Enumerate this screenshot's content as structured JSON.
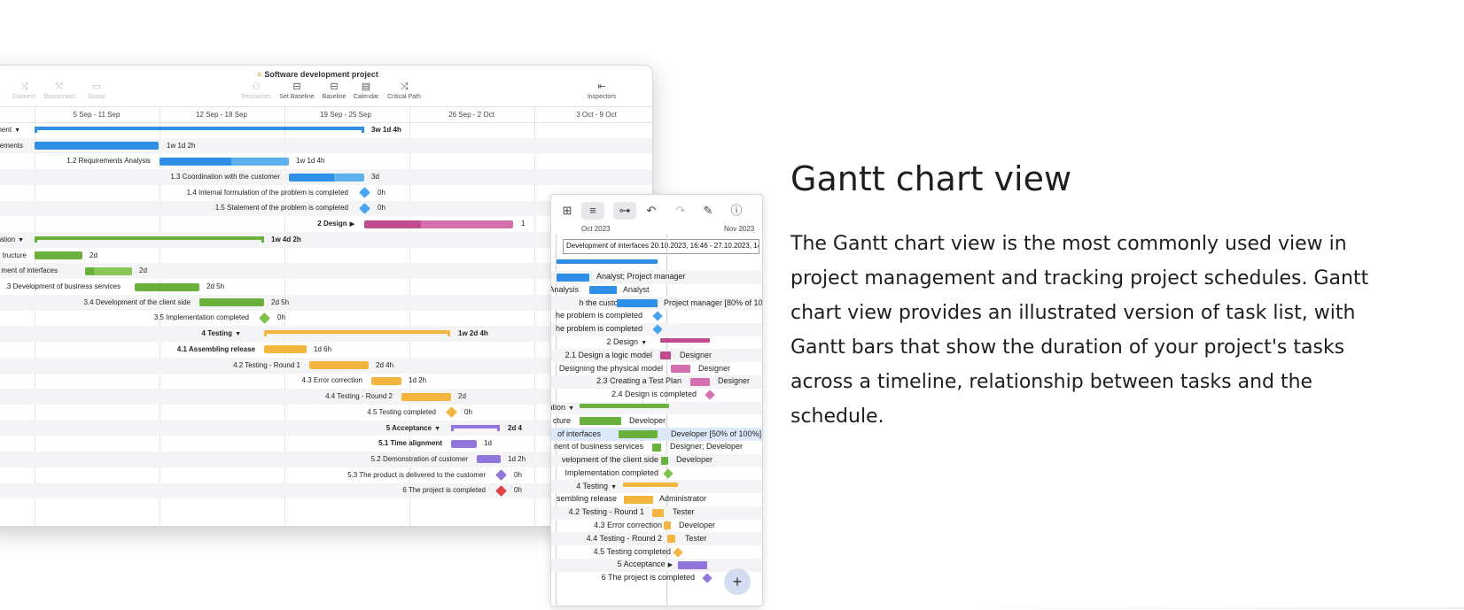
{
  "colors": {
    "blue": "#2f8ee6",
    "blue_light": "#5fb0ef",
    "green": "#6ab03c",
    "green_light": "#8cc55a",
    "magenta": "#c24a8e",
    "pink": "#d66fae",
    "orange": "#f3b53d",
    "purple": "#9376db",
    "red": "#e04348",
    "diamond_blue": "#4aa4ef",
    "diamond_green": "#7dc24b"
  },
  "desktop": {
    "title": "Software development project",
    "toolbar": [
      {
        "icon": "connect-icon",
        "label": "Connect",
        "enabled": false
      },
      {
        "icon": "disconnect-icon",
        "label": "Disconnect",
        "enabled": false
      },
      {
        "icon": "group-icon",
        "label": "Group",
        "enabled": false
      },
      {
        "icon": "resources-icon",
        "label": "Resources",
        "enabled": false
      },
      {
        "icon": "set-baseline-icon",
        "label": "Set Baseline",
        "enabled": true
      },
      {
        "icon": "baseline-icon",
        "label": "Baseline",
        "enabled": true
      },
      {
        "icon": "calendar-icon",
        "label": "Calendar",
        "enabled": true
      },
      {
        "icon": "critical-path-icon",
        "label": "Critical Path",
        "enabled": true
      },
      {
        "icon": "inspectors-icon",
        "label": "Inspectors",
        "enabled": true
      }
    ],
    "weeks": [
      "5 Sep - 11 Sep",
      "12 Sep - 18 Sep",
      "19 Sep - 25 Sep",
      "26 Sep - 2 Oct",
      "3 Oct - 9 Oct"
    ],
    "rows": [
      {
        "label": "ment",
        "expand": true,
        "bold": false,
        "type": "summary",
        "color": "blue",
        "duration": "3w 1d 4h"
      },
      {
        "label": "rements",
        "type": "bar",
        "color": "blue",
        "duration": "1w 1d 2h"
      },
      {
        "label": "1.2   Requirements Analysis",
        "type": "bar",
        "color": "blue",
        "duration": "1w 1d 4h"
      },
      {
        "label": "1.3   Coordination with the customer",
        "type": "bar",
        "color": "blue",
        "duration": "3d"
      },
      {
        "label": "1.4   Internal formulation of the problem is completed",
        "type": "milestone",
        "color": "diamond_blue",
        "duration": "0h"
      },
      {
        "label": "1.5   Statement of the problem is completed",
        "type": "milestone",
        "color": "diamond_blue",
        "duration": "0h"
      },
      {
        "label": "2   Design",
        "bold": true,
        "collapsed": true,
        "type": "bar",
        "color": "magenta",
        "duration": "1"
      },
      {
        "label": "ation",
        "expand": true,
        "type": "summary",
        "color": "green",
        "duration": "1w 4d 2h"
      },
      {
        "label": "tructure",
        "type": "bar",
        "color": "green",
        "duration": "2d"
      },
      {
        "label": "ment of interfaces",
        "type": "bar",
        "color": "green",
        "duration": "2d"
      },
      {
        "label": ".3   Development of business services",
        "type": "bar",
        "color": "green",
        "duration": "2d 5h"
      },
      {
        "label": "3.4   Development of the client side",
        "type": "bar",
        "color": "green",
        "duration": "2d 5h"
      },
      {
        "label": "3.5   Implementation completed",
        "type": "milestone",
        "color": "diamond_green",
        "duration": "0h"
      },
      {
        "label": "4   Testing",
        "bold": true,
        "expand": true,
        "type": "summary",
        "color": "orange",
        "duration": "1w 2d 4h"
      },
      {
        "label": "4.1   Assembling release",
        "bold_text": true,
        "type": "bar",
        "color": "orange",
        "duration": "1d 6h"
      },
      {
        "label": "4.2   Testing - Round 1",
        "type": "bar",
        "color": "orange",
        "duration": "2d 4h"
      },
      {
        "label": "4.3   Error correction",
        "type": "bar",
        "color": "orange",
        "duration": "1d 2h"
      },
      {
        "label": "4.4   Testing - Round 2",
        "type": "bar",
        "color": "orange",
        "duration": "2d"
      },
      {
        "label": "4.5   Testing completed",
        "type": "milestone",
        "color": "orange",
        "duration": "0h"
      },
      {
        "label": "5   Acceptance",
        "bold": true,
        "expand": true,
        "type": "summary",
        "color": "purple",
        "duration": "2d 4"
      },
      {
        "label": "5.1   Time alignment",
        "bold_text": true,
        "type": "bar",
        "color": "purple",
        "duration": "1d"
      },
      {
        "label": "5.2   Demonstration of customer",
        "type": "bar",
        "color": "purple",
        "duration": "1d 2h"
      },
      {
        "label": "5.3   The product is delivered to the customer",
        "type": "milestone",
        "color": "purple",
        "duration": "0h"
      },
      {
        "label": "6   The project is completed",
        "type": "milestone",
        "color": "red",
        "duration": "0h"
      }
    ]
  },
  "tablet": {
    "toolbar": [
      {
        "icon": "grid-icon"
      },
      {
        "icon": "baseline-icon",
        "selected": true
      },
      {
        "icon": "hierarchy-icon",
        "selected": true
      },
      {
        "icon": "undo-icon"
      },
      {
        "icon": "redo-icon",
        "dim": true
      },
      {
        "icon": "edit-icon"
      },
      {
        "icon": "info-icon"
      }
    ],
    "months": [
      "Oct 2023",
      "Nov 2023"
    ],
    "date_field": "Development of interfaces  20.10.2023, 16:46 - 27.10.2023, 14:",
    "rows": [
      {
        "label": "",
        "type": "summary",
        "color": "blue"
      },
      {
        "label": "",
        "type": "bar",
        "color": "blue",
        "resource": "Analyst; Project manager"
      },
      {
        "label": "Analysis",
        "type": "bar",
        "color": "blue",
        "resource": "Analyst"
      },
      {
        "label": "h the customer",
        "type": "bar",
        "color": "blue",
        "resource": "Project manager [80% of 10"
      },
      {
        "label": "he problem is completed",
        "type": "milestone",
        "color": "diamond_blue",
        "resource": ""
      },
      {
        "label": "he problem is completed",
        "type": "milestone",
        "color": "diamond_blue",
        "resource": ""
      },
      {
        "label": "2 Design",
        "expand": true,
        "type": "summary",
        "color": "magenta",
        "resource": ""
      },
      {
        "label": "2.1  Design a logic model",
        "type": "bar",
        "color": "magenta",
        "resource": "Designer"
      },
      {
        "label": "Designing the physical model",
        "type": "bar",
        "color": "pink",
        "resource": "Designer"
      },
      {
        "label": "2.3  Creating a Test Plan",
        "type": "bar",
        "color": "pink",
        "resource": "Designer"
      },
      {
        "label": "2.4  Design is completed",
        "type": "milestone",
        "color": "pink",
        "resource": ""
      },
      {
        "label": "ation",
        "expand": true,
        "type": "summary",
        "color": "green",
        "resource": ""
      },
      {
        "label": "cture",
        "type": "bar",
        "color": "green",
        "resource": "Developer"
      },
      {
        "label": "of interfaces",
        "type": "bar",
        "color": "green",
        "resource": "Developer [50% of 100%]",
        "selected": true
      },
      {
        "label": "nent of business services",
        "type": "bar",
        "color": "green",
        "resource": "Designer; Developer"
      },
      {
        "label": "velopment of the client side",
        "type": "bar",
        "color": "green",
        "resource": "Developer"
      },
      {
        "label": "Implementation completed",
        "type": "milestone",
        "color": "diamond_green",
        "resource": ""
      },
      {
        "label": "4 Testing",
        "expand": true,
        "type": "summary",
        "color": "orange",
        "resource": ""
      },
      {
        "label": "sembling release",
        "type": "bar",
        "color": "orange",
        "resource": "Administrator"
      },
      {
        "label": "4.2  Testing - Round 1",
        "type": "bar",
        "color": "orange",
        "resource": "Tester"
      },
      {
        "label": "4.3  Error correction",
        "type": "bar",
        "color": "orange",
        "resource": "Developer"
      },
      {
        "label": "4.4  Testing - Round 2",
        "type": "bar",
        "color": "orange",
        "resource": "Tester"
      },
      {
        "label": "4.5  Testing completed",
        "type": "milestone",
        "color": "orange",
        "resource": ""
      },
      {
        "label": "5 Acceptance",
        "collapsed": true,
        "type": "bar",
        "color": "purple",
        "resource": ""
      },
      {
        "label": "6  The project is completed",
        "type": "milestone",
        "color": "purple",
        "resource": ""
      }
    ],
    "add_button": "+"
  },
  "text": {
    "heading": "Gantt chart view",
    "body": "The Gantt chart view is the most commonly used view in project management and tracking project schedules. Gantt chart view provides an illustrated version of task list, with Gantt bars that show the duration of your project's tasks across a timeline, relationship between tasks and the schedule."
  }
}
